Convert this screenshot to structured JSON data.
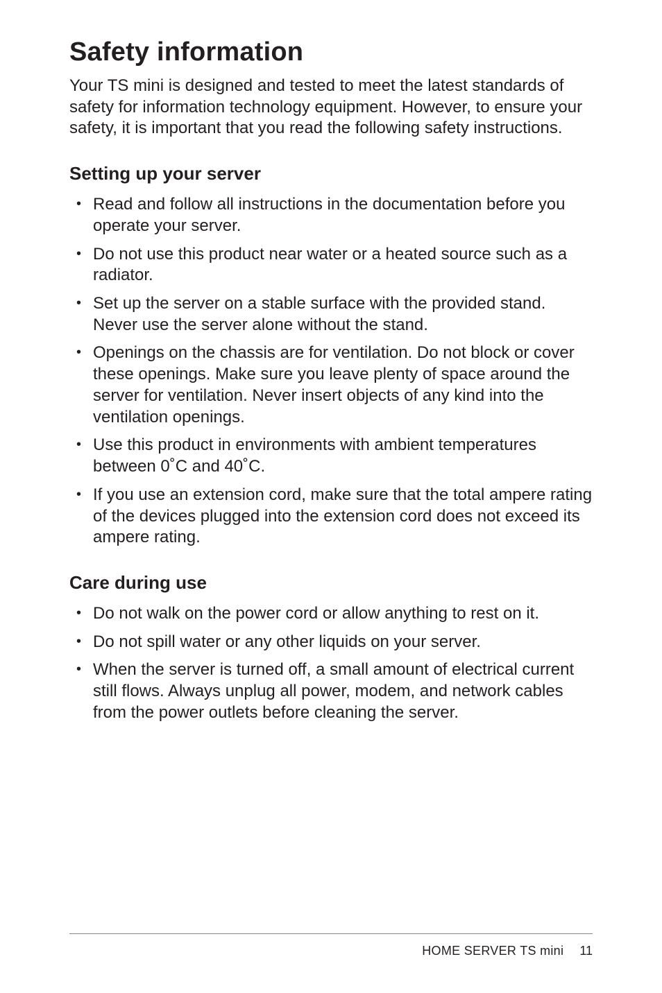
{
  "title": "Safety information",
  "intro": "Your TS mini is designed and tested to meet the latest standards of safety for information technology equipment. However, to ensure your safety, it is important that you read the following safety instructions.",
  "sections": [
    {
      "heading": "Setting up your server",
      "items": [
        "Read and follow all instructions in the documentation before you operate your server.",
        "Do not use this product near water or a heated source such as a radiator.",
        "Set up the server on a stable surface with the provided stand. Never use the server alone without the stand.",
        "Openings on the chassis are for ventilation. Do not block or cover these openings. Make sure you leave plenty of space around the server for ventilation. Never insert objects of any kind into the ventilation openings.",
        "Use this product in environments with ambient temperatures between 0˚C and 40˚C.",
        "If you use an extension cord, make sure that the total ampere rating of the devices plugged into the extension cord does not exceed its ampere rating."
      ]
    },
    {
      "heading": "Care during use",
      "items": [
        "Do not walk on the power cord or allow anything to rest on it.",
        "Do not spill water or any other liquids on your server.",
        "When the server is turned off, a small amount of electrical current still flows. Always unplug all power, modem, and network cables from the power outlets before cleaning the server."
      ]
    }
  ],
  "footer": {
    "product": "HOME SERVER TS mini",
    "page": "11"
  }
}
